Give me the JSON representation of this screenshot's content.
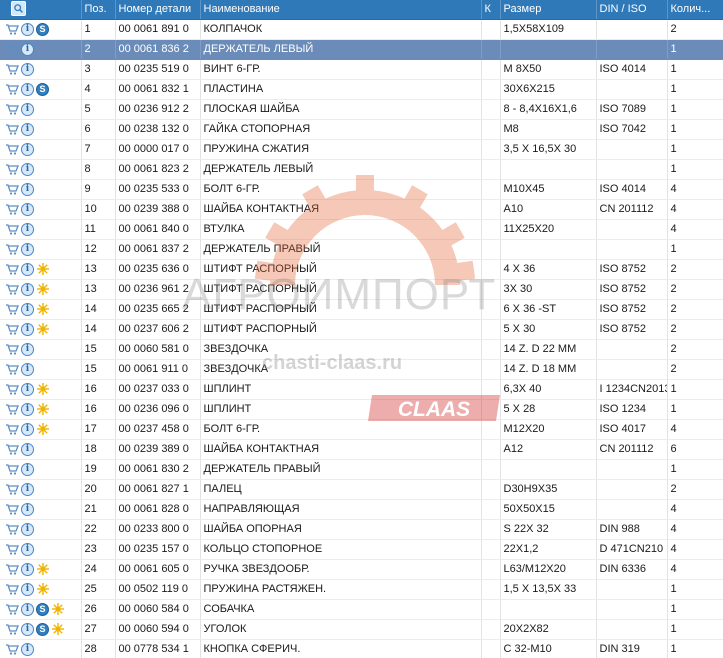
{
  "columns": {
    "icons": "",
    "pos": "Поз.",
    "number": "Номер детали",
    "name": "Наименование",
    "k": "К",
    "size": "Размер",
    "din": "DIN / ISO",
    "qty": "Колич..."
  },
  "icon_colors": {
    "cart": "#5b8ec4",
    "info": "#2a66a8",
    "s_badge": "#2f7fc1",
    "sun": "#f0b400",
    "header": "#2f79b9",
    "selected_row": "#6b8cb8"
  },
  "watermark": {
    "brand": "АГРОИМПОРТ",
    "site": "chasti-claas.ru",
    "logo": "CLAAS"
  },
  "rows": [
    {
      "icons": [
        "cart-icon",
        "info-icon",
        "s-icon"
      ],
      "pos": "1",
      "number": "00 0061 891 0",
      "name": "КОЛПАЧОК",
      "size": "1,5X58X109",
      "din": "",
      "qty": "2"
    },
    {
      "icons": [
        "cart-icon",
        "info-icon"
      ],
      "pos": "2",
      "number": "00 0061 836 2",
      "name": "ДЕРЖАТЕЛЬ ЛЕВЫЙ",
      "size": "",
      "din": "",
      "qty": "1",
      "selected": true
    },
    {
      "icons": [
        "cart-icon",
        "info-icon"
      ],
      "pos": "3",
      "number": "00 0235 519 0",
      "name": "ВИНТ 6-ГР.",
      "size": "M 8X50",
      "din": "ISO 4014",
      "qty": "1"
    },
    {
      "icons": [
        "cart-icon",
        "info-icon",
        "s-icon"
      ],
      "pos": "4",
      "number": "00 0061 832 1",
      "name": "ПЛАСТИНА",
      "size": "30X6X215",
      "din": "",
      "qty": "1"
    },
    {
      "icons": [
        "cart-icon",
        "info-icon"
      ],
      "pos": "5",
      "number": "00 0236 912 2",
      "name": "ПЛОСКАЯ ШАЙБА",
      "size": "8 - 8,4X16X1,6",
      "din": "ISO 7089",
      "qty": "1"
    },
    {
      "icons": [
        "cart-icon",
        "info-icon"
      ],
      "pos": "6",
      "number": "00 0238 132 0",
      "name": "ГАЙКА СТОПОРНАЯ",
      "size": "M8",
      "din": "ISO 7042",
      "qty": "1"
    },
    {
      "icons": [
        "cart-icon",
        "info-icon"
      ],
      "pos": "7",
      "number": "00 0000 017 0",
      "name": "ПРУЖИНА СЖАТИЯ",
      "size": "3,5 X 16,5X 30",
      "din": "",
      "qty": "1"
    },
    {
      "icons": [
        "cart-icon",
        "info-icon"
      ],
      "pos": "8",
      "number": "00 0061 823 2",
      "name": "ДЕРЖАТЕЛЬ ЛЕВЫЙ",
      "size": "",
      "din": "",
      "qty": "1"
    },
    {
      "icons": [
        "cart-icon",
        "info-icon"
      ],
      "pos": "9",
      "number": "00 0235 533 0",
      "name": "БОЛТ 6-ГР.",
      "size": "M10X45",
      "din": "ISO 4014",
      "qty": "4"
    },
    {
      "icons": [
        "cart-icon",
        "info-icon"
      ],
      "pos": "10",
      "number": "00 0239 388 0",
      "name": "ШАЙБА КОНТАКТНАЯ",
      "size": "A10",
      "din": "CN 201112",
      "qty": "4"
    },
    {
      "icons": [
        "cart-icon",
        "info-icon"
      ],
      "pos": "11",
      "number": "00 0061 840 0",
      "name": "ВТУЛКА",
      "size": "11X25X20",
      "din": "",
      "qty": "4"
    },
    {
      "icons": [
        "cart-icon",
        "info-icon"
      ],
      "pos": "12",
      "number": "00 0061 837 2",
      "name": "ДЕРЖАТЕЛЬ ПРАВЫЙ",
      "size": "",
      "din": "",
      "qty": "1"
    },
    {
      "icons": [
        "cart-icon",
        "info-icon",
        "sun-icon"
      ],
      "pos": "13",
      "number": "00 0235 636 0",
      "name": "ШТИФТ РАСПОРНЫЙ",
      "size": "4  X 36",
      "din": "ISO 8752",
      "qty": "2"
    },
    {
      "icons": [
        "cart-icon",
        "info-icon",
        "sun-icon"
      ],
      "pos": "13",
      "number": "00 0236 961 2",
      "name": "ШТИФТ РАСПОРНЫЙ",
      "size": "3X 30",
      "din": "ISO 8752",
      "qty": "2"
    },
    {
      "icons": [
        "cart-icon",
        "info-icon",
        "sun-icon"
      ],
      "pos": "14",
      "number": "00 0235 665 2",
      "name": "ШТИФТ РАСПОРНЫЙ",
      "size": "6 X 36 -ST",
      "din": "ISO 8752",
      "qty": "2"
    },
    {
      "icons": [
        "cart-icon",
        "info-icon",
        "sun-icon"
      ],
      "pos": "14",
      "number": "00 0237 606 2",
      "name": "ШТИФТ РАСПОРНЫЙ",
      "size": "5  X 30",
      "din": "ISO 8752",
      "qty": "2"
    },
    {
      "icons": [
        "cart-icon",
        "info-icon"
      ],
      "pos": "15",
      "number": "00 0060 581 0",
      "name": "ЗВЕЗДОЧКА",
      "size": "14 Z. D 22 MM",
      "din": "",
      "qty": "2"
    },
    {
      "icons": [
        "cart-icon",
        "info-icon"
      ],
      "pos": "15",
      "number": "00 0061 911 0",
      "name": "ЗВЕЗДОЧКА",
      "size": "14 Z. D 18 MM",
      "din": "",
      "qty": "2"
    },
    {
      "icons": [
        "cart-icon",
        "info-icon",
        "sun-icon"
      ],
      "pos": "16",
      "number": "00 0237 033 0",
      "name": "ШПЛИНТ",
      "size": "6,3X 40",
      "din": "I 1234CN2013",
      "qty": "1"
    },
    {
      "icons": [
        "cart-icon",
        "info-icon",
        "sun-icon"
      ],
      "pos": "16",
      "number": "00 0236 096 0",
      "name": "ШПЛИНТ",
      "size": "5 X 28",
      "din": "ISO 1234",
      "qty": "1"
    },
    {
      "icons": [
        "cart-icon",
        "info-icon",
        "sun-icon"
      ],
      "pos": "17",
      "number": "00 0237 458 0",
      "name": "БОЛТ 6-ГР.",
      "size": "M12X20",
      "din": "ISO 4017",
      "qty": "4"
    },
    {
      "icons": [
        "cart-icon",
        "info-icon"
      ],
      "pos": "18",
      "number": "00 0239 389 0",
      "name": "ШАЙБА КОНТАКТНАЯ",
      "size": "A12",
      "din": "CN 201112",
      "qty": "6"
    },
    {
      "icons": [
        "cart-icon",
        "info-icon"
      ],
      "pos": "19",
      "number": "00 0061 830 2",
      "name": "ДЕРЖАТЕЛЬ ПРАВЫЙ",
      "size": "",
      "din": "",
      "qty": "1"
    },
    {
      "icons": [
        "cart-icon",
        "info-icon"
      ],
      "pos": "20",
      "number": "00 0061 827 1",
      "name": "ПАЛЕЦ",
      "size": "D30H9X35",
      "din": "",
      "qty": "2"
    },
    {
      "icons": [
        "cart-icon",
        "info-icon"
      ],
      "pos": "21",
      "number": "00 0061 828 0",
      "name": "НАПРАВЛЯЮЩАЯ",
      "size": "50X50X15",
      "din": "",
      "qty": "4"
    },
    {
      "icons": [
        "cart-icon",
        "info-icon"
      ],
      "pos": "22",
      "number": "00 0233 800 0",
      "name": "ШАЙБА ОПОРНАЯ",
      "size": "S 22X 32",
      "din": "DIN 988",
      "qty": "4"
    },
    {
      "icons": [
        "cart-icon",
        "info-icon"
      ],
      "pos": "23",
      "number": "00 0235 157 0",
      "name": "КОЛЬЦО СТОПОРНОЕ",
      "size": "22X1,2",
      "din": "D  471CN210",
      "qty": "4"
    },
    {
      "icons": [
        "cart-icon",
        "info-icon",
        "sun-icon"
      ],
      "pos": "24",
      "number": "00 0061 605 0",
      "name": "РУЧКА ЗВЕЗДООБР.",
      "size": "L63/M12X20",
      "din": "DIN 6336",
      "qty": "4"
    },
    {
      "icons": [
        "cart-icon",
        "info-icon",
        "sun-icon"
      ],
      "pos": "25",
      "number": "00 0502 119 0",
      "name": "ПРУЖИНА РАСТЯЖЕН.",
      "size": "1,5 X 13,5X 33",
      "din": "",
      "qty": "1"
    },
    {
      "icons": [
        "cart-icon",
        "info-icon",
        "s-icon",
        "sun-icon"
      ],
      "pos": "26",
      "number": "00 0060 584 0",
      "name": "СОБАЧКА",
      "size": "",
      "din": "",
      "qty": "1"
    },
    {
      "icons": [
        "cart-icon",
        "info-icon",
        "s-icon",
        "sun-icon"
      ],
      "pos": "27",
      "number": "00 0060 594 0",
      "name": "УГОЛОК",
      "size": "20X2X82",
      "din": "",
      "qty": "1"
    },
    {
      "icons": [
        "cart-icon",
        "info-icon"
      ],
      "pos": "28",
      "number": "00 0778 534 1",
      "name": "КНОПКА СФЕРИЧ.",
      "size": "C 32-M10",
      "din": "DIN 319",
      "qty": "1"
    }
  ]
}
